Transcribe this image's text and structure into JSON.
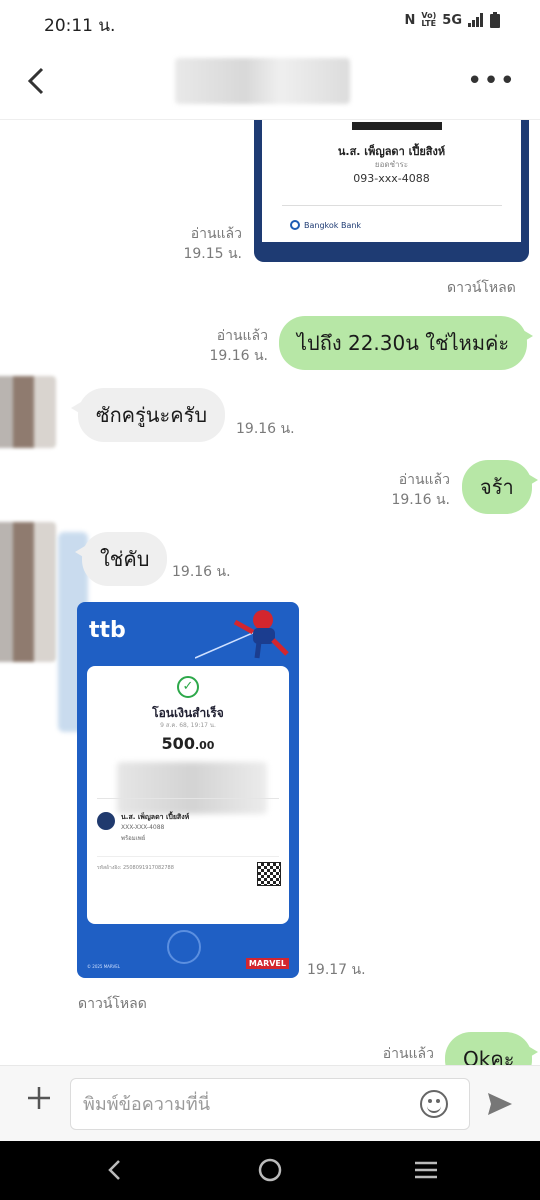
{
  "status_bar": {
    "time": "20:11 น.",
    "icons": [
      "nfc-icon",
      "volte-icon",
      "5g-icon",
      "signal-icon",
      "battery-icon"
    ],
    "network": "5G"
  },
  "header": {
    "back_icon": "chevron-left-icon",
    "more_icon": "more-horizontal-icon"
  },
  "receipt1": {
    "name": "น.ส. เพ็ญลดา เปี้ยสิงห์",
    "sub": "ยอดชำระ",
    "phone": "093-xxx-4088",
    "bank": "Bangkok Bank"
  },
  "messages": {
    "m1_meta_read": "อ่านแล้ว",
    "m1_meta_time": "19.15 น.",
    "download1": "ดาวน์โหลด",
    "m2_text": "ไปถึง 22.30น ใช่ไหมค่ะ",
    "m2_read": "อ่านแล้ว",
    "m2_time": "19.16 น.",
    "m3_text": "ซักครู่นะครับ",
    "m3_time": "19.16 น.",
    "m4_text": "จร้า",
    "m4_read": "อ่านแล้ว",
    "m4_time": "19.16 น.",
    "m5_text": "ใช่คับ",
    "m5_time": "19.16 น.",
    "m6_time": "19.17 น.",
    "download2": "ดาวน์โหลด",
    "m7_text": "Okคะ",
    "m7_read": "อ่านแล้ว"
  },
  "receipt2": {
    "logo": "ttb",
    "title": "โอนเงินสำเร็จ",
    "date": "9 ส.ค. 68, 19:17 น.",
    "amount_main": "500",
    "amount_dec": ".00",
    "recipient_name": "น.ส. เพ็ญลดา เปี้ยสิงห์",
    "recipient_acc": "XXX-XXX-4088",
    "recipient_via": "พร้อมเพย์",
    "ref": "รหัสอ้างอิง: 2508091917082788",
    "marvel": "MARVEL",
    "copyright": "© 2025 MARVEL"
  },
  "input": {
    "placeholder": "พิมพ์ข้อความที่นี่"
  },
  "colors": {
    "outgoing_bubble": "#b7e7a6",
    "incoming_bubble": "#efefef",
    "ttb_blue": "#1f5fc4"
  }
}
